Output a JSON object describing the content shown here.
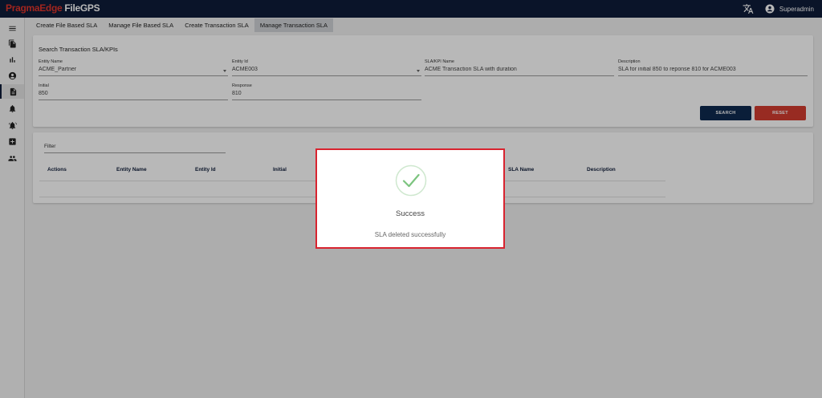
{
  "header": {
    "brand": "PragmaEdge",
    "product": "FileGPS",
    "user": "Superadmin",
    "translate_icon": "translate-icon",
    "account_icon": "account-circle-icon"
  },
  "sidebar": {
    "icons": [
      "menu-icon",
      "copy-files-icon",
      "bar-chart-icon",
      "account-icon",
      "document-icon",
      "notification-icon",
      "notification-active-icon",
      "add-box-icon",
      "people-icon"
    ],
    "active_index": 4
  },
  "tabs": [
    {
      "label": "Create File Based SLA"
    },
    {
      "label": "Manage File Based SLA"
    },
    {
      "label": "Create Transaction SLA"
    },
    {
      "label": "Manage Transaction SLA",
      "active": true
    }
  ],
  "search": {
    "title": "Search Transaction SLA/KPIs",
    "fields": {
      "entity_name": {
        "label": "Entity Name",
        "value": "ACME_Partner"
      },
      "entity_id": {
        "label": "Entity Id",
        "value": "ACME003"
      },
      "sla_name": {
        "label": "SLA/KPI Name",
        "value": "ACME Transaction SLA with duration"
      },
      "description": {
        "label": "Description",
        "value": "SLA for initial 850 to reponse 810 for ACME003"
      },
      "initial": {
        "label": "Initial",
        "value": "850"
      },
      "response": {
        "label": "Response",
        "value": "810"
      }
    },
    "search_label": "SEARCH",
    "reset_label": "RESET"
  },
  "results": {
    "filter_placeholder": "Filter",
    "columns": [
      "Actions",
      "Entity Name",
      "Entity Id",
      "Initial",
      "SLA Name",
      "Description"
    ]
  },
  "dialog": {
    "title": "Success",
    "message": "SLA deleted successfully",
    "icon": "check-circle-icon"
  },
  "colors": {
    "header_bg": "#0f1d3a",
    "brand_red": "#e0342a",
    "search_button": "#0f2a4f",
    "reset_button": "#d33c30",
    "success_green": "#7cc47f",
    "highlight_border": "#d8232f"
  }
}
